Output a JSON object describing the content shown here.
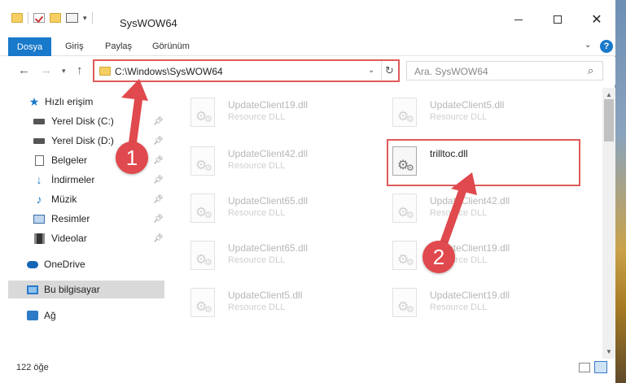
{
  "window": {
    "title": "SysWOW64"
  },
  "ribbon": {
    "tabs": [
      {
        "label": "Dosya"
      },
      {
        "label": "Giriş"
      },
      {
        "label": "Paylaş"
      },
      {
        "label": "Görünüm"
      }
    ]
  },
  "address": {
    "path": "C:\\Windows\\SysWOW64"
  },
  "search": {
    "placeholder": "Ara. SysWOW64"
  },
  "navpane": {
    "quick_access": "Hızlı erişim",
    "items": [
      {
        "label": "Yerel Disk (C:)"
      },
      {
        "label": "Yerel Disk (D:)"
      },
      {
        "label": "Belgeler"
      },
      {
        "label": "İndirmeler"
      },
      {
        "label": "Müzik"
      },
      {
        "label": "Resimler"
      },
      {
        "label": "Videolar"
      }
    ],
    "onedrive": "OneDrive",
    "this_pc": "Bu bilgisayar",
    "network": "Ağ"
  },
  "files": [
    {
      "name": "UpdateClient19.dll",
      "type": "Resource DLL"
    },
    {
      "name": "UpdateClient5.dll",
      "type": "Resource DLL"
    },
    {
      "name": "UpdateClient42.dll",
      "type": "Resource DLL"
    },
    {
      "name": "trilltoc.dll",
      "type": ""
    },
    {
      "name": "UpdateClient65.dll",
      "type": "Resource DLL"
    },
    {
      "name": "UpdateClient42.dll",
      "type": "Resource DLL"
    },
    {
      "name": "UpdateClient65.dll",
      "type": "Resource DLL"
    },
    {
      "name": "UpdateClient19.dll",
      "type": "Resource DLL"
    },
    {
      "name": "UpdateClient5.dll",
      "type": "Resource DLL"
    },
    {
      "name": "UpdateClient19.dll",
      "type": "Resource DLL"
    }
  ],
  "status": {
    "count": "122 öğe"
  },
  "callouts": {
    "one": "1",
    "two": "2"
  },
  "colors": {
    "accent": "#1979ca",
    "highlight": "#e05a5a"
  }
}
